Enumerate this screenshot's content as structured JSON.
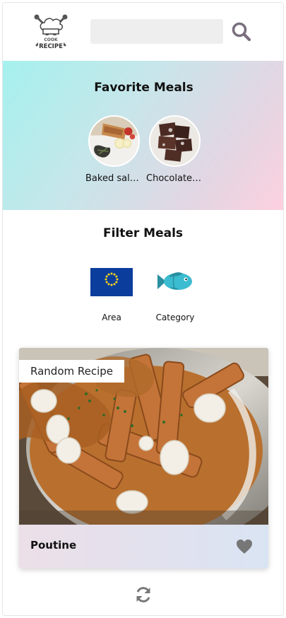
{
  "header": {
    "logo_text_top": "COOK",
    "logo_text_bottom": "RECIPE",
    "search": {
      "value": "",
      "placeholder": ""
    },
    "search_icon": "search-icon"
  },
  "favorites": {
    "title": "Favorite Meals",
    "items": [
      {
        "label": "Baked salmon with fennel & tomatoes",
        "image": "baked-salmon-photo"
      },
      {
        "label": "Chocolate Raspberry Brownies",
        "image": "chocolate-brownies-photo"
      }
    ]
  },
  "filter": {
    "title": "Filter Meals",
    "options": [
      {
        "label": "Area",
        "icon": "eu-flag-icon"
      },
      {
        "label": "Category",
        "icon": "fish-icon"
      }
    ]
  },
  "random_recipe": {
    "badge": "Random Recipe",
    "meal_name": "Poutine",
    "image": "poutine-photo",
    "favorite_icon": "heart-icon"
  },
  "refresh_icon": "refresh-icon",
  "colors": {
    "favorites_gradient_start": "#a5f1ee",
    "favorites_gradient_end": "#fdd0df",
    "icon_gray": "#777777",
    "search_bg": "#eeeeee"
  }
}
